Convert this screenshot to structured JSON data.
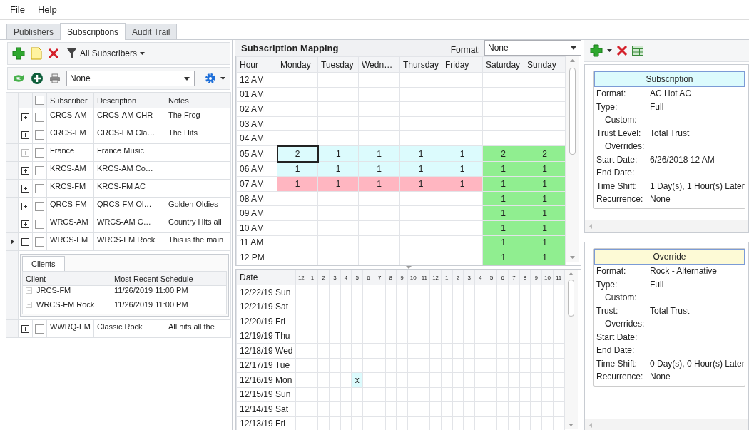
{
  "menu": [
    "File",
    "Help"
  ],
  "tabs": [
    {
      "label": "Publishers",
      "selected": false
    },
    {
      "label": "Subscriptions",
      "selected": true
    },
    {
      "label": "Audit Trail",
      "selected": false
    }
  ],
  "subscribers_panel": {
    "filter_label": "All Subscribers",
    "view_combo": {
      "value": "None"
    },
    "table": {
      "columns": [
        "Subscriber",
        "Description",
        "Notes"
      ],
      "header_checked": false,
      "rows": [
        {
          "subscriber": "CRCS-AM",
          "description": "CRCS-AM CHR",
          "notes": "The Frog",
          "expandable": true,
          "expanded": false,
          "current": false,
          "checked": false
        },
        {
          "subscriber": "CRCS-FM",
          "description": "CRCS-FM Cla…",
          "notes": "The Hits",
          "expandable": true,
          "expanded": false,
          "current": false,
          "checked": false
        },
        {
          "subscriber": "France",
          "description": "France Music",
          "expandable": false,
          "expanded": false,
          "current": false,
          "checked": false
        },
        {
          "subscriber": "KRCS-AM",
          "description": "KRCS-AM Co…",
          "expandable": true,
          "expanded": false,
          "current": false,
          "checked": false
        },
        {
          "subscriber": "KRCS-FM",
          "description": "KRCS-FM AC",
          "expandable": true,
          "expanded": false,
          "current": false,
          "checked": false
        },
        {
          "subscriber": "QRCS-FM",
          "description": "QRCS-FM Ol…",
          "notes": "Golden Oldies",
          "expandable": true,
          "expanded": false,
          "current": false,
          "checked": false
        },
        {
          "subscriber": "WRCS-AM",
          "description": "WRCS-AM C…",
          "notes": "Country Hits all",
          "expandable": true,
          "expanded": false,
          "current": false,
          "checked": false
        },
        {
          "subscriber": "WRCS-FM",
          "description": "WRCS-FM Rock",
          "notes": "This is the main",
          "expandable": true,
          "expanded": true,
          "current": true,
          "checked": false,
          "detail": {
            "tab": "Clients",
            "columns": [
              "Client",
              "Most Recent Schedule"
            ],
            "rows": [
              {
                "client": "JRCS-FM",
                "schedule": "11/26/2019 11:00 PM"
              },
              {
                "client": "WRCS-FM Rock",
                "schedule": "11/26/2019 11:00 PM"
              }
            ]
          }
        },
        {
          "subscriber": "WWRQ-FM",
          "description": "Classic Rock",
          "notes": "All hits all the",
          "expandable": true,
          "expanded": false,
          "current": false,
          "checked": false
        }
      ]
    }
  },
  "mapping": {
    "title": "Subscription Mapping",
    "format_label": "Format:",
    "format_combo": {
      "value": "None"
    },
    "hour_column": "Hour",
    "day_columns": [
      "Monday",
      "Tuesday",
      "Wedn…",
      "Thursday",
      "Friday",
      "Saturday",
      "Sunday"
    ],
    "rows": [
      {
        "hour": "12 AM",
        "cells": [
          {},
          {},
          {},
          {},
          {},
          {},
          {}
        ]
      },
      {
        "hour": "01 AM",
        "cells": [
          {},
          {},
          {},
          {},
          {},
          {},
          {}
        ]
      },
      {
        "hour": "02 AM",
        "cells": [
          {},
          {},
          {},
          {},
          {},
          {},
          {}
        ]
      },
      {
        "hour": "03 AM",
        "cells": [
          {},
          {},
          {},
          {},
          {},
          {},
          {}
        ]
      },
      {
        "hour": "04 AM",
        "cells": [
          {},
          {},
          {},
          {},
          {},
          {},
          {}
        ]
      },
      {
        "hour": "05 AM",
        "cells": [
          {
            "value": "2",
            "color": "#dcfbfd",
            "selected": true
          },
          {
            "value": "1",
            "color": "#dcfbfd",
            "selected": false
          },
          {
            "value": "1",
            "color": "#dcfbfd",
            "selected": false
          },
          {
            "value": "1",
            "color": "#dcfbfd",
            "selected": false
          },
          {
            "value": "1",
            "color": "#dcfbfd",
            "selected": false
          },
          {
            "value": "2",
            "color": "#90ee90",
            "selected": false
          },
          {
            "value": "2",
            "color": "#90ee90",
            "selected": false
          }
        ]
      },
      {
        "hour": "06 AM",
        "cells": [
          {
            "value": "1",
            "color": "#dcfbfd",
            "selected": false
          },
          {
            "value": "1",
            "color": "#dcfbfd",
            "selected": false
          },
          {
            "value": "1",
            "color": "#dcfbfd",
            "selected": false
          },
          {
            "value": "1",
            "color": "#dcfbfd",
            "selected": false
          },
          {
            "value": "1",
            "color": "#dcfbfd",
            "selected": false
          },
          {
            "value": "1",
            "color": "#90ee90",
            "selected": false
          },
          {
            "value": "1",
            "color": "#90ee90",
            "selected": false
          }
        ]
      },
      {
        "hour": "07 AM",
        "cells": [
          {
            "value": "1",
            "color": "#ffb6c1",
            "selected": false
          },
          {
            "value": "1",
            "color": "#ffb6c1",
            "selected": false
          },
          {
            "value": "1",
            "color": "#ffb6c1",
            "selected": false
          },
          {
            "value": "1",
            "color": "#ffb6c1",
            "selected": false
          },
          {
            "value": "1",
            "color": "#ffb6c1",
            "selected": false
          },
          {
            "value": "1",
            "color": "#90ee90",
            "selected": false
          },
          {
            "value": "1",
            "color": "#90ee90",
            "selected": false
          }
        ]
      },
      {
        "hour": "08 AM",
        "cells": [
          {},
          {},
          {},
          {},
          {},
          {
            "value": "1",
            "color": "#90ee90",
            "selected": false
          },
          {
            "value": "1",
            "color": "#90ee90",
            "selected": false
          }
        ]
      },
      {
        "hour": "09 AM",
        "cells": [
          {},
          {},
          {},
          {},
          {},
          {
            "value": "1",
            "color": "#90ee90",
            "selected": false
          },
          {
            "value": "1",
            "color": "#90ee90",
            "selected": false
          }
        ]
      },
      {
        "hour": "10 AM",
        "cells": [
          {},
          {},
          {},
          {},
          {},
          {
            "value": "1",
            "color": "#90ee90",
            "selected": false
          },
          {
            "value": "1",
            "color": "#90ee90",
            "selected": false
          }
        ]
      },
      {
        "hour": "11 AM",
        "cells": [
          {},
          {},
          {},
          {},
          {},
          {
            "value": "1",
            "color": "#90ee90",
            "selected": false
          },
          {
            "value": "1",
            "color": "#90ee90",
            "selected": false
          }
        ]
      },
      {
        "hour": "12 PM",
        "cells": [
          {},
          {},
          {},
          {},
          {},
          {
            "value": "1",
            "color": "#90ee90",
            "selected": false
          },
          {
            "value": "1",
            "color": "#90ee90",
            "selected": false
          }
        ]
      }
    ]
  },
  "schedule": {
    "date_label": "Date",
    "hours": [
      "12",
      "1",
      "2",
      "3",
      "4",
      "5",
      "6",
      "7",
      "8",
      "9",
      "10",
      "11",
      "12",
      "1",
      "2",
      "3",
      "4",
      "5",
      "6",
      "7",
      "8",
      "9",
      "10",
      "11"
    ],
    "rows": [
      {
        "date": "12/22/19 Sun",
        "cells": [
          {},
          {},
          {},
          {},
          {},
          {},
          {},
          {},
          {},
          {},
          {},
          {},
          {},
          {},
          {},
          {},
          {},
          {},
          {},
          {},
          {},
          {},
          {},
          {}
        ]
      },
      {
        "date": "12/21/19 Sat",
        "cells": [
          {},
          {},
          {},
          {},
          {},
          {},
          {},
          {},
          {},
          {},
          {},
          {},
          {},
          {},
          {},
          {},
          {},
          {},
          {},
          {},
          {},
          {},
          {},
          {}
        ]
      },
      {
        "date": "12/20/19 Fri",
        "cells": [
          {},
          {},
          {},
          {},
          {},
          {},
          {},
          {},
          {},
          {},
          {},
          {},
          {},
          {},
          {},
          {},
          {},
          {},
          {},
          {},
          {},
          {},
          {},
          {}
        ]
      },
      {
        "date": "12/19/19 Thu",
        "cells": [
          {},
          {},
          {},
          {},
          {},
          {},
          {},
          {},
          {},
          {},
          {},
          {},
          {},
          {},
          {},
          {},
          {},
          {},
          {},
          {},
          {},
          {},
          {},
          {}
        ]
      },
      {
        "date": "12/18/19 Wed",
        "cells": [
          {},
          {},
          {},
          {},
          {},
          {},
          {},
          {},
          {},
          {},
          {},
          {},
          {},
          {},
          {},
          {},
          {},
          {},
          {},
          {},
          {},
          {},
          {},
          {}
        ]
      },
      {
        "date": "12/17/19 Tue",
        "cells": [
          {},
          {},
          {},
          {},
          {},
          {},
          {},
          {},
          {},
          {},
          {},
          {},
          {},
          {},
          {},
          {},
          {},
          {},
          {},
          {},
          {},
          {},
          {},
          {}
        ]
      },
      {
        "date": "12/16/19 Mon",
        "cells": [
          {},
          {},
          {},
          {},
          {},
          {
            "mark": "x",
            "color": "#dcfbfd"
          },
          {},
          {},
          {},
          {},
          {},
          {},
          {},
          {},
          {},
          {},
          {},
          {},
          {},
          {},
          {},
          {},
          {},
          {}
        ]
      },
      {
        "date": "12/15/19 Sun",
        "cells": [
          {},
          {},
          {},
          {},
          {},
          {},
          {},
          {},
          {},
          {},
          {},
          {},
          {},
          {},
          {},
          {},
          {},
          {},
          {},
          {},
          {},
          {},
          {},
          {}
        ]
      },
      {
        "date": "12/14/19 Sat",
        "cells": [
          {},
          {},
          {},
          {},
          {},
          {},
          {},
          {},
          {},
          {},
          {},
          {},
          {},
          {},
          {},
          {},
          {},
          {},
          {},
          {},
          {},
          {},
          {},
          {}
        ]
      },
      {
        "date": "12/13/19 Fri",
        "cells": [
          {},
          {},
          {},
          {},
          {},
          {},
          {},
          {},
          {},
          {},
          {},
          {},
          {},
          {},
          {},
          {},
          {},
          {},
          {},
          {},
          {},
          {},
          {},
          {}
        ]
      }
    ]
  },
  "cards": [
    {
      "kind": "subscription",
      "title": "Subscription",
      "fields": [
        {
          "label": "Format:",
          "value": "AC Hot AC"
        },
        {
          "label": "Type:",
          "value": "Full",
          "children": [
            {
              "label": "Custom:"
            }
          ]
        },
        {
          "label": "Trust Level:",
          "value": "Total Trust",
          "children": [
            {
              "label": "Overrides:"
            }
          ]
        },
        {
          "label": "Start Date:",
          "value": "6/26/2018 12 AM"
        },
        {
          "label": "End Date:"
        },
        {
          "label": "Time Shift:",
          "value": "1 Day(s), 1 Hour(s) Later"
        },
        {
          "label": "Recurrence:",
          "value": "None"
        }
      ]
    },
    {
      "kind": "override",
      "title": "Override",
      "fields": [
        {
          "label": "Format:",
          "value": "Rock - Alternative"
        },
        {
          "label": "Type:",
          "value": "Full",
          "children": [
            {
              "label": "Custom:"
            }
          ]
        },
        {
          "label": "Trust:",
          "value": "Total Trust",
          "children": [
            {
              "label": "Overrides:"
            }
          ]
        },
        {
          "label": "Start Date:"
        },
        {
          "label": "End Date:"
        },
        {
          "label": "Time Shift:",
          "value": "0 Day(s), 0 Hour(s) Later"
        },
        {
          "label": "Recurrence:",
          "value": "None"
        }
      ]
    }
  ]
}
